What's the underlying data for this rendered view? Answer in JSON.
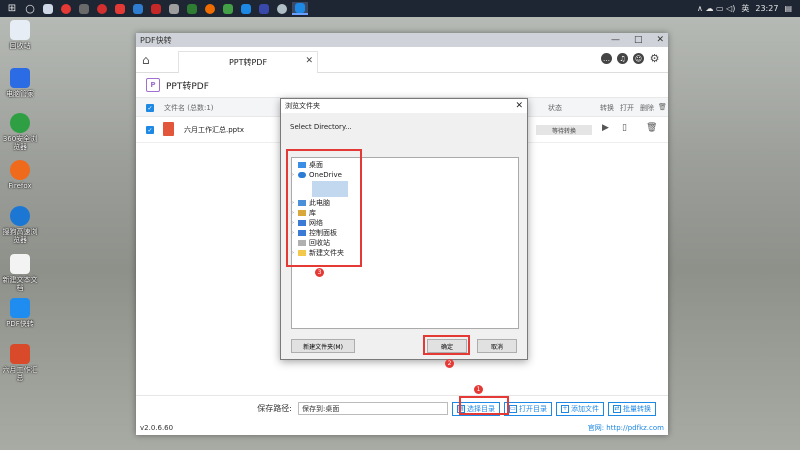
{
  "taskbar": {
    "tray_lang": "英",
    "clock": "23:27",
    "tray_symbols": "∧ ☁ ▭ ◁)"
  },
  "desktop_icons": [
    {
      "label": "回收站",
      "color": "#e6edf5"
    },
    {
      "label": "电脑管家",
      "color": "#2b6be3"
    },
    {
      "label": "360安全浏览器",
      "color": "#2ea043"
    },
    {
      "label": "Firefox",
      "color": "#ef6a1a"
    },
    {
      "label": "搜狗高速浏览器",
      "color": "#1b77d3"
    },
    {
      "label": "新建文本文档",
      "color": "#f3f3f3"
    },
    {
      "label": "PDF快转",
      "color": "#1f8df0"
    },
    {
      "label": "六月工作汇总",
      "color": "#d94a2b"
    }
  ],
  "app": {
    "title": "PDF快转",
    "controls": {
      "minimize": "—",
      "maximize": "□",
      "close": "✕"
    },
    "tab_label": "PPT转PDF",
    "tab_close": "✕",
    "tool_icons": [
      "…",
      "♫",
      "☺",
      "⚙"
    ],
    "section_title": "PPT转PDF",
    "ppt_logo_letters": "P",
    "columns": {
      "name": "文件名 (总数:1)",
      "status": "状态",
      "convert": "转换",
      "open": "打开",
      "delete": "删除"
    },
    "file": {
      "name": "六月工作汇总.pptx",
      "status": "等待转换"
    },
    "save_path_label": "保存路径:",
    "save_path_value": "保存到:桌面",
    "buttons": {
      "choose_dir": "选择目录",
      "open_dir": "打开目录",
      "add_file": "添加文件",
      "batch_convert": "批量转换"
    },
    "version": "v2.0.6.60",
    "website": "官网: http://pdfkz.com"
  },
  "dialog": {
    "title": "浏览文件夹",
    "close": "✕",
    "prompt": "Select Directory...",
    "tree": [
      {
        "label": "桌面",
        "color": "#3a8ee6",
        "expand": ""
      },
      {
        "label": "OneDrive",
        "color": "#2b7cd3",
        "expand": "›"
      },
      {
        "label": "此电脑",
        "color": "#4a90d9",
        "expand": "›"
      },
      {
        "label": "库",
        "color": "#d9a83a",
        "expand": "›"
      },
      {
        "label": "网络",
        "color": "#3a7bd5",
        "expand": "›"
      },
      {
        "label": "控制面板",
        "color": "#3a7bd5",
        "expand": "›"
      },
      {
        "label": "回收站",
        "color": "#b0b0b0",
        "expand": ""
      },
      {
        "label": "新建文件夹",
        "color": "#f2c94c",
        "expand": "›"
      }
    ],
    "new_folder_button": "新建文件夹(M)",
    "ok_button": "确定",
    "cancel_button": "取消"
  },
  "annotations": {
    "badge1": "1",
    "badge2": "2",
    "badge3": "3"
  }
}
